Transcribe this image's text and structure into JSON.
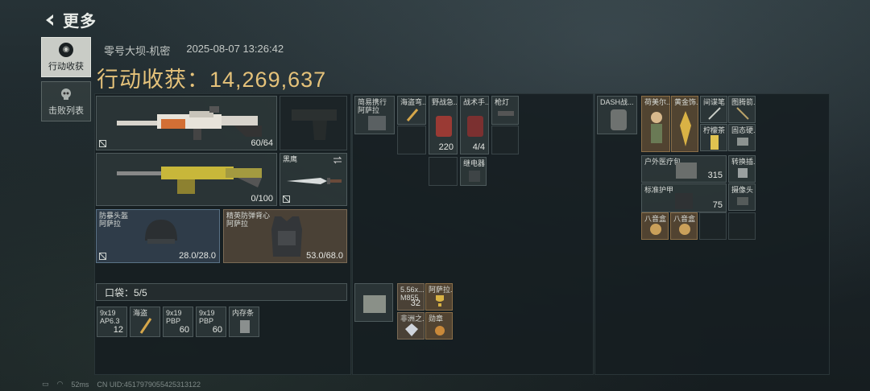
{
  "header": {
    "title": "更多"
  },
  "side_tabs": [
    {
      "label": "行动收获",
      "active": true,
      "icon": "target-icon"
    },
    {
      "label": "击败列表",
      "active": false,
      "icon": "skull-icon"
    }
  ],
  "meta": {
    "map": "零号大坝-机密",
    "datetime": "2025-08-07 13:26:42"
  },
  "harvest": {
    "label": "行动收获：",
    "value": "14,269,637"
  },
  "weapons": {
    "primary1_ammo": "60/64",
    "primary2_ammo": "0/100",
    "melee_label": "黑鹰"
  },
  "armor": {
    "helmet": {
      "name": "防暴头盔",
      "sub": "阿萨拉",
      "durability": "28.0/28.0"
    },
    "vest": {
      "name": "精英防弹背心",
      "sub": "阿萨拉",
      "durability": "53.0/68.0"
    }
  },
  "pocket": {
    "label": "口袋：5/5",
    "items": [
      {
        "name": "9x19",
        "sub": "AP6.3",
        "count": "12"
      },
      {
        "name": "海盗",
        "sub": "",
        "count": ""
      },
      {
        "name": "9x19",
        "sub": "PBP",
        "count": "60"
      },
      {
        "name": "9x19",
        "sub": "PBP",
        "count": "60"
      },
      {
        "name": "内存条",
        "sub": "",
        "count": ""
      }
    ]
  },
  "chest_rig": {
    "name": "简易携行",
    "sub": "阿萨拉",
    "items": [
      {
        "name": "海盗弯..."
      },
      {
        "name": "野战急...",
        "count": "220"
      },
      {
        "name": "战术手...",
        "count": "4/4"
      },
      {
        "name": "枪灯"
      },
      {
        "name": "继电器"
      }
    ]
  },
  "belt": {
    "items": [
      {
        "name": "5.56x...",
        "sub": "M855",
        "count": "32"
      },
      {
        "name": "阿萨拉..."
      },
      {
        "name": "非洲之..."
      },
      {
        "name": "勋章"
      }
    ]
  },
  "backpack": {
    "name": "DASH战...",
    "items": [
      {
        "name": "荷美尔..."
      },
      {
        "name": "黄金饰..."
      },
      {
        "name": "间谍笔"
      },
      {
        "name": "图腾箭..."
      },
      {
        "name": "柠檬茶"
      },
      {
        "name": "固态硬..."
      },
      {
        "name": "户外医疗包",
        "count": "315"
      },
      {
        "name": "转换插..."
      },
      {
        "name": "标准护甲",
        "count": "75"
      },
      {
        "name": "摄像头"
      },
      {
        "name": "八音盒"
      },
      {
        "name": "八音盒"
      }
    ]
  },
  "footer": {
    "ping": "52ms",
    "uid": "CN UID:4517979055425313122"
  },
  "colors": {
    "accent_gold": "#e5c27a",
    "panel": "#161e21"
  }
}
